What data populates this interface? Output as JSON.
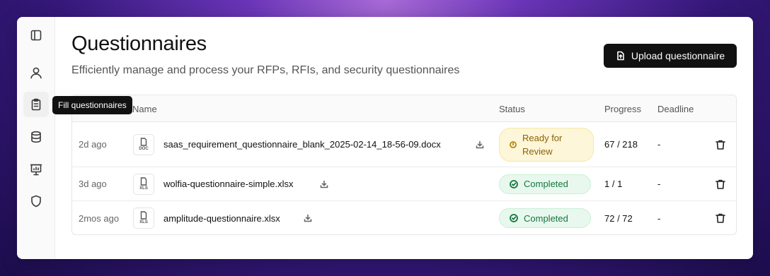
{
  "colors": {
    "accent": "#111111",
    "review_bg": "#fdf6d8",
    "review_text": "#8a6408",
    "done_bg": "#e8f8ee",
    "done_text": "#17763f"
  },
  "sidebar": {
    "items": [
      {
        "icon": "panel-toggle-icon"
      },
      {
        "icon": "user-icon"
      },
      {
        "icon": "clipboard-icon",
        "active": true
      },
      {
        "icon": "database-icon"
      },
      {
        "icon": "presentation-icon"
      },
      {
        "icon": "shield-icon"
      }
    ],
    "tooltip": "Fill questionnaires"
  },
  "header": {
    "title": "Questionnaires",
    "subtitle": "Efficiently manage and process your RFPs, RFIs, and security questionnaires",
    "upload_label": "Upload questionnaire"
  },
  "table": {
    "columns": {
      "name": "Name",
      "status": "Status",
      "progress": "Progress",
      "deadline": "Deadline"
    },
    "rows": [
      {
        "date": "2d ago",
        "type": "DOC",
        "name": "saas_requirement_questionnaire_blank_2025-02-14_18-56-09.docx",
        "status": "Ready for Review",
        "progress": "67 / 218",
        "deadline": "-"
      },
      {
        "date": "3d ago",
        "type": "XLS",
        "name": "wolfia-questionnaire-simple.xlsx",
        "status": "Completed",
        "progress": "1 / 1",
        "deadline": "-"
      },
      {
        "date": "2mos ago",
        "type": "XLS",
        "name": "amplitude-questionnaire.xlsx",
        "status": "Completed",
        "progress": "72 / 72",
        "deadline": "-"
      }
    ]
  }
}
